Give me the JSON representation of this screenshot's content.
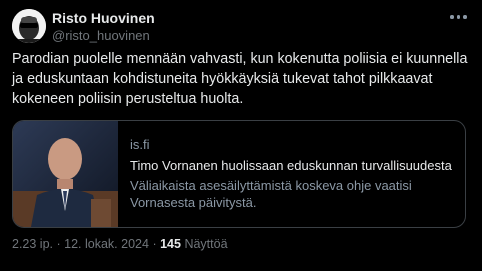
{
  "author": {
    "display_name": "Risto Huovinen",
    "handle": "@risto_huovinen"
  },
  "tweet": {
    "text": "Parodian puolelle mennään vahvasti, kun kokenutta poliisia ei kuunnella ja eduskuntaan kohdistuneita hyökkäyksiä tukevat tahot pilkkaavat kokeneen poliisin perusteltua huolta."
  },
  "card": {
    "domain": "is.fi",
    "title": "Timo Vornanen huolissaan eduskunnan turvallisuudesta",
    "description": "Väliaikaista asesäilyttämistä koskeva ohje vaatisi Vornasesta päivitystä."
  },
  "meta": {
    "time": "2.23 ip.",
    "separator": "·",
    "date": "12. lokak. 2024",
    "views_count": "145",
    "views_label": "Näyttöä"
  },
  "icons": {
    "more": "more-horizontal-icon"
  },
  "colors": {
    "background": "#000000",
    "text_primary": "#e7e9ea",
    "text_secondary": "#71767b",
    "border": "#3a3f44"
  }
}
